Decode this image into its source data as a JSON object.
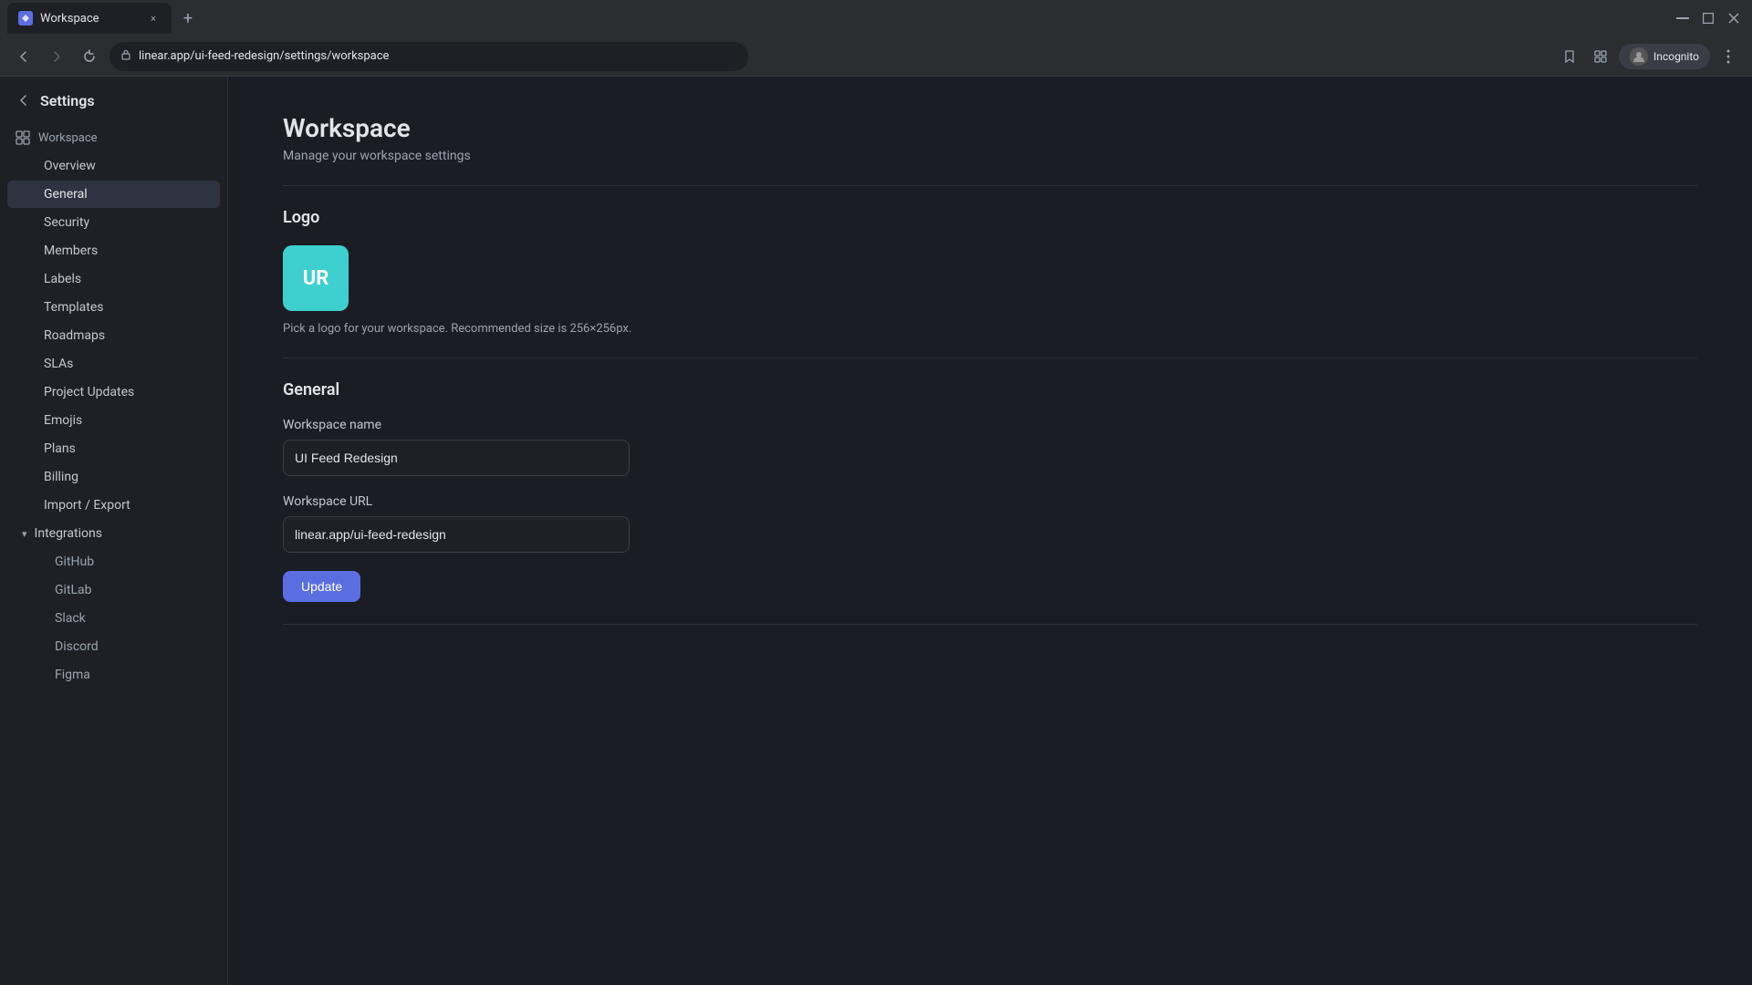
{
  "browser": {
    "tab": {
      "favicon": "W",
      "title": "Workspace",
      "close": "×"
    },
    "new_tab": "+",
    "url": "linear.app/ui-feed-redesign/settings/workspace",
    "nav": {
      "back": "←",
      "forward": "→",
      "reload": "↻"
    },
    "incognito_label": "Incognito",
    "menu": "⋮",
    "bookmark": "☆",
    "extensions": "⊞",
    "window_controls": {
      "minimize": "—",
      "maximize": "⧉",
      "close": "✕"
    }
  },
  "sidebar": {
    "back_label": "‹",
    "settings_title": "Settings",
    "workspace_section": {
      "icon": "⊞",
      "label": "Workspace"
    },
    "nav_items": [
      {
        "id": "overview",
        "label": "Overview"
      },
      {
        "id": "general",
        "label": "General"
      },
      {
        "id": "security",
        "label": "Security"
      },
      {
        "id": "members",
        "label": "Members"
      },
      {
        "id": "labels",
        "label": "Labels"
      },
      {
        "id": "templates",
        "label": "Templates"
      },
      {
        "id": "roadmaps",
        "label": "Roadmaps"
      },
      {
        "id": "slas",
        "label": "SLAs"
      },
      {
        "id": "project-updates",
        "label": "Project Updates"
      },
      {
        "id": "emojis",
        "label": "Emojis"
      },
      {
        "id": "plans",
        "label": "Plans"
      },
      {
        "id": "billing",
        "label": "Billing"
      },
      {
        "id": "import-export",
        "label": "Import / Export"
      }
    ],
    "integrations": {
      "label": "Integrations",
      "chevron": "▾",
      "items": [
        {
          "id": "github",
          "label": "GitHub"
        },
        {
          "id": "gitlab",
          "label": "GitLab"
        },
        {
          "id": "slack",
          "label": "Slack"
        },
        {
          "id": "discord",
          "label": "Discord"
        },
        {
          "id": "figma",
          "label": "Figma"
        }
      ]
    }
  },
  "main": {
    "page_title": "Workspace",
    "page_subtitle": "Manage your workspace settings",
    "logo_section": {
      "title": "Logo",
      "initials": "UR",
      "hint": "Pick a logo for your workspace. Recommended size is 256×256px."
    },
    "general_section": {
      "title": "General",
      "workspace_name_label": "Workspace name",
      "workspace_name_value": "UI Feed Redesign",
      "workspace_url_label": "Workspace URL",
      "workspace_url_value": "linear.app/ui-feed-redesign",
      "update_button": "Update"
    }
  }
}
